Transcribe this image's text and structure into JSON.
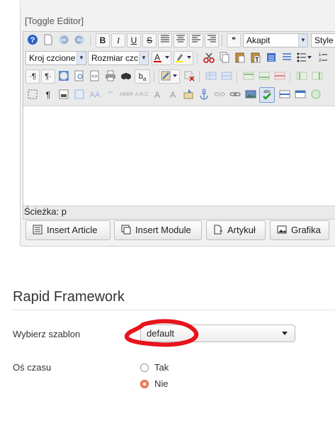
{
  "editor": {
    "toggle_label": "[Toggle Editor]",
    "format_select": "Akapit",
    "style_select": "Style",
    "font_family_select": "Kroj czcione",
    "font_size_select": "Rozmiar czc",
    "path_label": "Ścieżka: p",
    "buttons": {
      "insert_article": "Insert Article",
      "insert_module": "Insert Module",
      "artykul": "Artykuł",
      "grafika": "Grafika"
    },
    "toolbar_glyphs": {
      "bold": "B",
      "italic": "I",
      "underline": "U",
      "strike": "S",
      "blockquote": "❝",
      "pilcrow": "¶",
      "ltr": "·¶",
      "rtl": "¶·",
      "abbr": "A",
      "cite": "“”",
      "spell": "abc"
    }
  },
  "rapid": {
    "title": "Rapid Framework",
    "template_label": "Wybierz szablon",
    "template_value": "default",
    "timeline_label": "Oś czasu",
    "options": [
      {
        "label": "Tak",
        "checked": false
      },
      {
        "label": "Nie",
        "checked": true
      }
    ]
  },
  "colors": {
    "accent_red": "#e8141c",
    "radio_checked": "#f1896a"
  }
}
